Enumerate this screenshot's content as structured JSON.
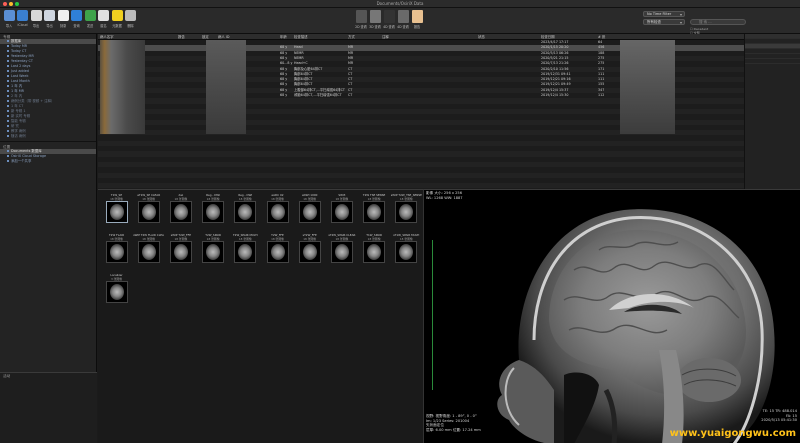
{
  "window": {
    "title": "Documents/OsiriX Data"
  },
  "toolbar": {
    "items": [
      {
        "label": "导入",
        "color": "#5b8fd4"
      },
      {
        "label": "iCloud",
        "color": "#3a7fd0"
      },
      {
        "label": "导出",
        "color": "#d8d8d8"
      },
      {
        "label": "导出",
        "color": "#cfd6e0"
      },
      {
        "label": "刻录",
        "color": "#f0f0f0"
      },
      {
        "label": "查询",
        "color": "#2f80d8"
      },
      {
        "label": "发送",
        "color": "#3ea34a"
      },
      {
        "label": "匿名",
        "color": "#e0e0e0"
      },
      {
        "label": "元数据",
        "color": "#f0d020"
      },
      {
        "label": "删除",
        "color": "#bbbbbb"
      }
    ],
    "center": [
      {
        "label": "2D 查看",
        "color": "#555"
      },
      {
        "label": "3D 查看",
        "color": "#777"
      },
      {
        "label": "4D 查看",
        "color": "#333"
      },
      {
        "label": "4D 查看",
        "color": "#6a6a6a"
      },
      {
        "label": "报告",
        "color": "#e8c090"
      }
    ],
    "time_filter": "No Time Filter",
    "sort": "所有检查",
    "search_placeholder": "搜 索 ...",
    "check_a": "Decedent",
    "check_b": "全部"
  },
  "sidebar": {
    "header1": "专辑",
    "albums": [
      "数据库",
      "Today MR",
      "Today CT",
      "Yesterday MR",
      "Yesterday CT",
      "Last 2 days",
      "Just added",
      "Last Week",
      "Last Month",
      "1 年 内",
      "1 年 MR",
      "2 年 内",
      "病例分类（带 视频 + 注释）",
      "1 年 CT",
      "新 专辑 1",
      "新 实时 专辑",
      "智能 专辑",
      "研 究",
      "教学 病例",
      "随访 病例"
    ],
    "header2": "位置",
    "locations": [
      "Documents 数据库",
      "OsiriX Cloud Storage",
      "添加一个共享"
    ]
  },
  "activity": {
    "title": "活动"
  },
  "table": {
    "headers": [
      "病人名字",
      "报告",
      "锁定",
      "病人 ID",
      "年龄",
      "检查描述",
      "方式",
      "注释",
      "状态",
      "检查日期",
      "# 张"
    ],
    "rows": [
      {
        "age": "",
        "desc": "",
        "mod": "",
        "comment": "",
        "date": "2023/4/17 17:17",
        "n": "64"
      },
      {
        "age": "68 y",
        "desc": "Head",
        "mod": "MR",
        "comment": "",
        "date": "2020/1/15 20:20",
        "n": "456"
      },
      {
        "age": "68 y",
        "desc": "NEMR",
        "mod": "MR",
        "comment": "",
        "date": "2020/5/13 06:26",
        "n": "188"
      },
      {
        "age": "68 y",
        "desc": "NEMR",
        "mod": "MR",
        "comment": "",
        "date": "2020/5/21 21:15",
        "n": "275"
      },
      {
        "age": "60...8 y",
        "desc": "Head+C",
        "mod": "MR",
        "comment": "",
        "date": "2020/7/13 21:26",
        "n": "275"
      },
      {
        "age": "68 y",
        "desc": "胸部及心脏64排CT",
        "mod": "CT",
        "comment": "",
        "date": "2020/2/10 11:56",
        "n": "171"
      },
      {
        "age": "68 y",
        "desc": "胸部64排CT",
        "mod": "CT",
        "comment": "",
        "date": "2019/12/31 09:41",
        "n": "111"
      },
      {
        "age": "68 y",
        "desc": "胸部64排CT",
        "mod": "CT",
        "comment": "",
        "date": "2019/12/21 09:16",
        "n": "111"
      },
      {
        "age": "68 y",
        "desc": "胸部64排CT",
        "mod": "CT",
        "comment": "",
        "date": "2019/12/21 09:49",
        "n": "155"
      },
      {
        "age": "68 y",
        "desc": "上腹部64排CT,...平扫增强64排CT",
        "mod": "CT",
        "comment": "",
        "date": "2019/12/4 15:37",
        "n": "347"
      },
      {
        "age": "68 y",
        "desc": "颅脑64排CT,...平扫增强64排CT",
        "mod": "CT",
        "comment": "",
        "date": "2019/12/4 15:30",
        "n": "112"
      }
    ]
  },
  "series": [
    {
      "title": "T1W_SE",
      "count": "18 张图像"
    },
    {
      "title": "eT1W_SE CLEAR",
      "count": "18 张图像"
    },
    {
      "title": "dwi",
      "count": "18 张图像"
    },
    {
      "title": "Reg - DWI",
      "count": "18 张图像"
    },
    {
      "title": "Reg - DWI",
      "count": "18 张图像"
    },
    {
      "title": "eADC 02",
      "count": "18 张图像"
    },
    {
      "title": "eDWI 1000",
      "count": "18 张图像"
    },
    {
      "title": "SWI3",
      "count": "18 张图像"
    },
    {
      "title": "T2W TSE SENSE",
      "count": "18 张图像"
    },
    {
      "title": "sWIP T2W_TSE_SENSE",
      "count": "18 张图像"
    },
    {
      "title": "T2W FLAIR",
      "count": "18 张图像"
    },
    {
      "title": "sWIP T2W FLAIR CLEAR",
      "count": "18 张图像"
    },
    {
      "title": "sWIP T2W_FFE",
      "count": "18 张图像"
    },
    {
      "title": "T2W_SPAIR",
      "count": "18 张图像"
    },
    {
      "title": "T2W_SPAIR MULTI",
      "count": "18 张图像"
    },
    {
      "title": "T2W_FFE",
      "count": "18 张图像"
    },
    {
      "title": "sT2W_FFE",
      "count": "18 张图像"
    },
    {
      "title": "sT2W_SPAIR CLEAR",
      "count": "18 张图像"
    },
    {
      "title": "T1W_SPAIR",
      "count": "18 张图像"
    },
    {
      "title": "sT1W_SPAIR MULTI",
      "count": "18 张图像"
    },
    {
      "title": "Localizer",
      "count": "3 张图像"
    }
  ],
  "viewer": {
    "top_left_1": "影像 大小: 256 x 256",
    "top_left_2": "WL: 1268 WW: 1887",
    "bottom_left_1": "视野: 视野角度: 1 - 89°, 0 - 0°",
    "bottom_left_2": "Im: 1/23  Series: 201004",
    "bottom_left_3": "矢状面定位",
    "bottom_left_4": "层厚: 6.00 mm 位置: 17.24 mm",
    "bottom_right_1": "TE: 15 TR: 488.014",
    "bottom_right_2": "FA: 15",
    "bottom_right_3": "2020/5/13 05:41:30",
    "watermark": "www.yuaigongwu.com"
  }
}
